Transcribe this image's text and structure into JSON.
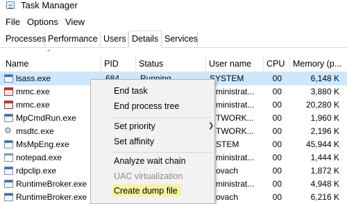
{
  "window": {
    "title": "Task Manager"
  },
  "menu": [
    "File",
    "Options",
    "View"
  ],
  "tabs": [
    {
      "label": "Processes",
      "active": false
    },
    {
      "label": "Performance",
      "active": false
    },
    {
      "label": "Users",
      "active": false
    },
    {
      "label": "Details",
      "active": true
    },
    {
      "label": "Services",
      "active": false
    }
  ],
  "columns": {
    "name": "Name",
    "pid": "PID",
    "status": "Status",
    "user": "User name",
    "cpu": "CPU",
    "memory": "Memory (p..."
  },
  "rows": [
    {
      "name": "lsass.exe",
      "pid": "684",
      "status": "Running",
      "user": "SYSTEM",
      "cpu": "00",
      "memory": "6,148 K",
      "icon": "window-icon"
    },
    {
      "name": "mmc.exe",
      "pid": "",
      "status": "",
      "user": "ministrat...",
      "cpu": "00",
      "memory": "3,880 K",
      "icon": "mmc-icon"
    },
    {
      "name": "mmc.exe",
      "pid": "",
      "status": "",
      "user": "ministrat...",
      "cpu": "00",
      "memory": "20,280 K",
      "icon": "mmc-icon"
    },
    {
      "name": "MpCmdRun.exe",
      "pid": "",
      "status": "",
      "user": "TWORK...",
      "cpu": "00",
      "memory": "1,960 K",
      "icon": "window-icon"
    },
    {
      "name": "msdtc.exe",
      "pid": "",
      "status": "",
      "user": "TWORK...",
      "cpu": "00",
      "memory": "2,196 K",
      "icon": "gear-icon"
    },
    {
      "name": "MsMpEng.exe",
      "pid": "",
      "status": "",
      "user": "STEM",
      "cpu": "00",
      "memory": "45,944 K",
      "icon": "window-icon"
    },
    {
      "name": "notepad.exe",
      "pid": "",
      "status": "",
      "user": "ministrat...",
      "cpu": "00",
      "memory": "1,444 K",
      "icon": "notepad-icon"
    },
    {
      "name": "rdpclip.exe",
      "pid": "",
      "status": "",
      "user": "ovach",
      "cpu": "00",
      "memory": "1,872 K",
      "icon": "window-icon"
    },
    {
      "name": "RuntimeBroker.exe",
      "pid": "",
      "status": "",
      "user": "ministrat...",
      "cpu": "00",
      "memory": "4,948 K",
      "icon": "window-icon"
    },
    {
      "name": "RuntimeBroker.exe",
      "pid": "",
      "status": "",
      "user": "ovach",
      "cpu": "00",
      "memory": "6,216 K",
      "icon": "window-icon"
    }
  ],
  "context_menu": {
    "items": [
      {
        "label": "End task",
        "enabled": true,
        "submenu": false
      },
      {
        "label": "End process tree",
        "enabled": true,
        "submenu": false
      },
      {
        "label": "Set priority",
        "enabled": true,
        "submenu": true
      },
      {
        "label": "Set affinity",
        "enabled": true,
        "submenu": false
      },
      {
        "label": "Analyze wait chain",
        "enabled": true,
        "submenu": false
      },
      {
        "label": "UAC virtualization",
        "enabled": false,
        "submenu": false
      },
      {
        "label": "Create dump file",
        "enabled": true,
        "submenu": false,
        "highlighted": true
      }
    ]
  },
  "colors": {
    "selection": "#cce8ff",
    "highlight": "#f7f39a",
    "menu_bg": "#f2f2f2"
  }
}
